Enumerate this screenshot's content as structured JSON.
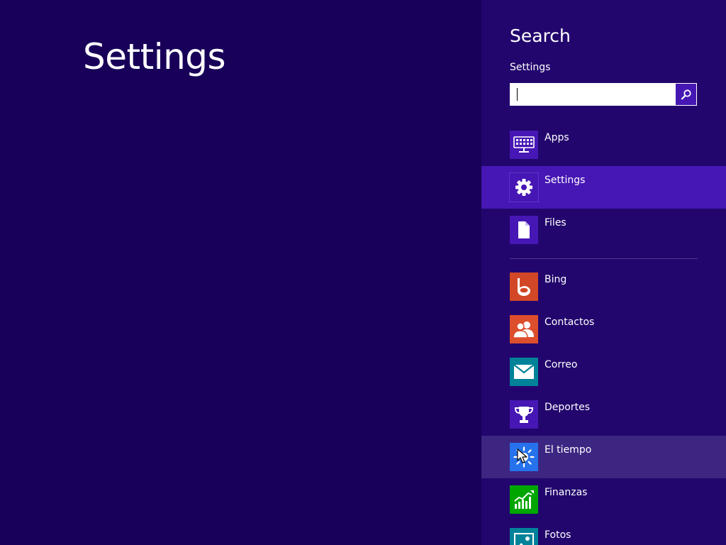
{
  "main": {
    "title": "Settings"
  },
  "search_pane": {
    "title": "Search",
    "scope_label": "Settings",
    "search": {
      "value": "",
      "placeholder": ""
    },
    "search_button_icon": "magnifier-icon",
    "categories": [
      {
        "label": "Apps",
        "icon": "apps-icon",
        "tile_color": "#4617b4",
        "state": "normal"
      },
      {
        "label": "Settings",
        "icon": "gear-icon",
        "tile_color": "#4617b4",
        "state": "selected"
      },
      {
        "label": "Files",
        "icon": "file-icon",
        "tile_color": "#4617b4",
        "state": "normal"
      }
    ],
    "apps": [
      {
        "label": "Bing",
        "icon": "bing-icon",
        "tile_color": "#d24726",
        "state": "normal"
      },
      {
        "label": "Contactos",
        "icon": "people-icon",
        "tile_color": "#dc4e2c",
        "state": "normal"
      },
      {
        "label": "Correo",
        "icon": "mail-icon",
        "tile_color": "#008299",
        "state": "normal"
      },
      {
        "label": "Deportes",
        "icon": "trophy-icon",
        "tile_color": "#4617b4",
        "state": "normal"
      },
      {
        "label": "El tiempo",
        "icon": "sun-icon",
        "tile_color": "#2672ec",
        "state": "hover"
      },
      {
        "label": "Finanzas",
        "icon": "chart-icon",
        "tile_color": "#00a600",
        "state": "normal"
      },
      {
        "label": "Fotos",
        "icon": "photo-icon",
        "tile_color": "#008299",
        "state": "normal"
      }
    ]
  },
  "colors": {
    "background": "#180059",
    "pane_background": "#22066d",
    "accent": "#4617b4",
    "hover": "#3d2682"
  }
}
